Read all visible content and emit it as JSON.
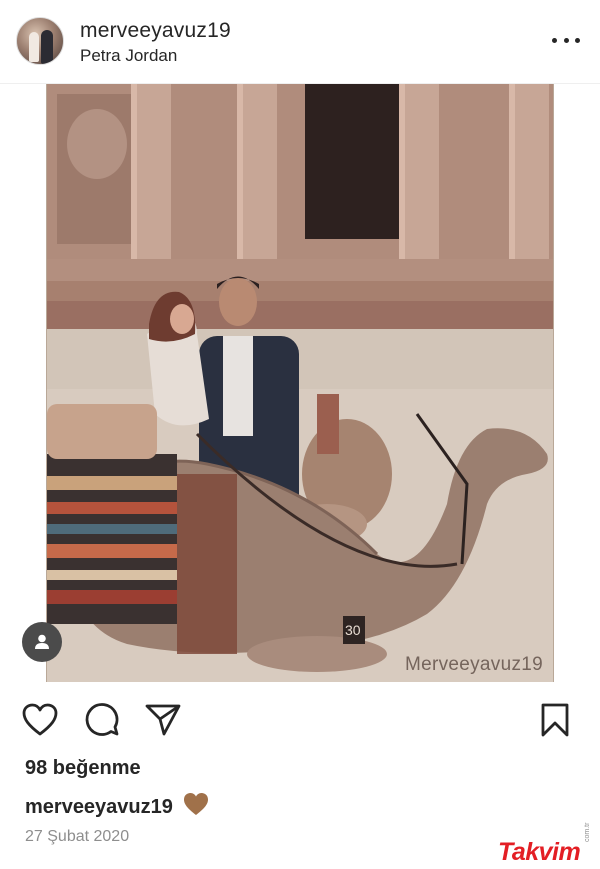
{
  "post": {
    "username": "merveeyavuz19",
    "location": "Petra Jordan",
    "watermark": "Merveeyavuz19",
    "likes": "98 beğenme",
    "caption_username": "merveeyavuz19",
    "caption_emoji": "brown-heart-emoji",
    "date": "27 Şubat 2020"
  },
  "icons": {
    "more": "more-options-icon",
    "like": "heart-outline-icon",
    "comment": "comment-bubble-icon",
    "share": "paper-plane-icon",
    "save": "bookmark-icon",
    "user_tag": "person-icon"
  },
  "branding": {
    "logo_text": "Takvim",
    "logo_suffix": "com.tr"
  },
  "colors": {
    "text": "#262626",
    "muted": "#8e8e8e",
    "heart_emoji": "#a0714a",
    "logo_red": "#e31e24"
  }
}
